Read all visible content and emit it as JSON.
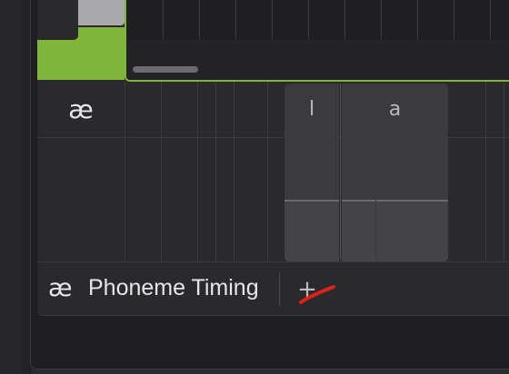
{
  "phoneme_row": {
    "symbol": "æ"
  },
  "phonemes": [
    {
      "label": "l"
    },
    {
      "label": "a"
    }
  ],
  "bottom_tab": {
    "symbol": "æ",
    "label": "Phoneme Timing",
    "add_symbol": "+"
  },
  "colors": {
    "accent_green": "#7fb63a",
    "annotation_red": "#e0201b",
    "background": "#2a2a2c"
  },
  "icons": {
    "add": "plus-icon",
    "annotation": "red-strike-mark"
  }
}
